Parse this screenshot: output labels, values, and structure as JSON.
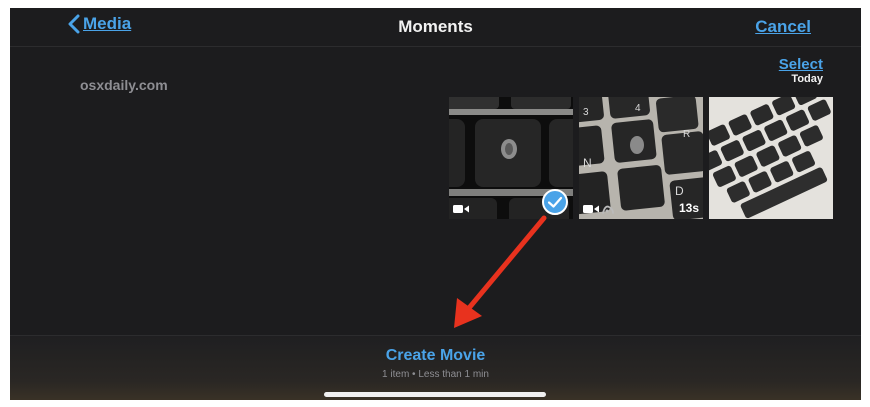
{
  "navbar": {
    "back_label": "Media",
    "title": "Moments",
    "cancel_label": "Cancel"
  },
  "watermark": "osxdaily.com",
  "section": {
    "select_label": "Select",
    "date_label": "Today"
  },
  "thumbnails": [
    {
      "type": "video",
      "selected": true,
      "duration": ""
    },
    {
      "type": "video-slomo",
      "selected": false,
      "duration": "13s"
    },
    {
      "type": "photo",
      "selected": false,
      "duration": ""
    }
  ],
  "bottom": {
    "create_label": "Create Movie",
    "summary": "1 item • Less than 1 min"
  },
  "colors": {
    "accent": "#4aa3e8",
    "background": "#1c1c1e",
    "annotation_arrow": "#e8321e"
  },
  "icons": [
    "chevron-left-icon",
    "video-camera-icon",
    "slomo-icon",
    "checkmark-icon"
  ]
}
